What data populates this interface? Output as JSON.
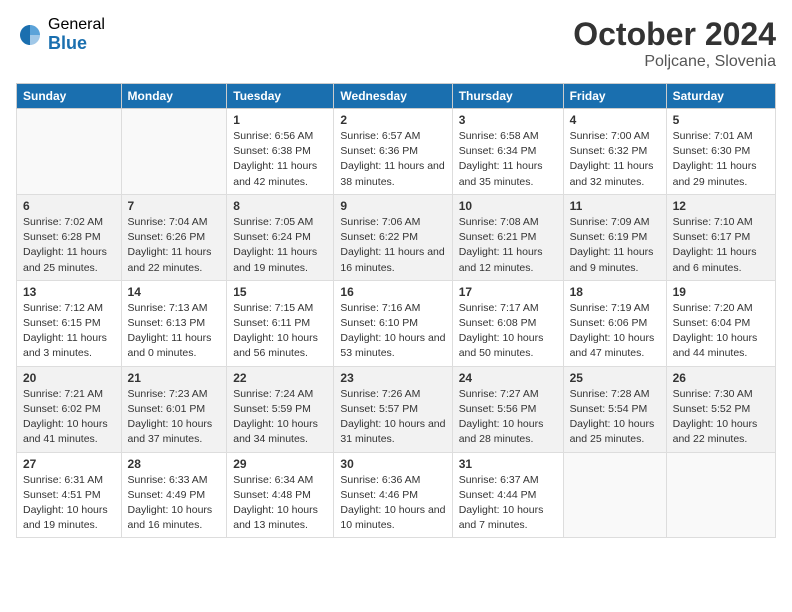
{
  "logo": {
    "general": "General",
    "blue": "Blue"
  },
  "title": {
    "month_year": "October 2024",
    "location": "Poljcane, Slovenia"
  },
  "headers": [
    "Sunday",
    "Monday",
    "Tuesday",
    "Wednesday",
    "Thursday",
    "Friday",
    "Saturday"
  ],
  "weeks": [
    [
      {
        "day": "",
        "info": ""
      },
      {
        "day": "",
        "info": ""
      },
      {
        "day": "1",
        "sunrise": "6:56 AM",
        "sunset": "6:38 PM",
        "daylight": "11 hours and 42 minutes."
      },
      {
        "day": "2",
        "sunrise": "6:57 AM",
        "sunset": "6:36 PM",
        "daylight": "11 hours and 38 minutes."
      },
      {
        "day": "3",
        "sunrise": "6:58 AM",
        "sunset": "6:34 PM",
        "daylight": "11 hours and 35 minutes."
      },
      {
        "day": "4",
        "sunrise": "7:00 AM",
        "sunset": "6:32 PM",
        "daylight": "11 hours and 32 minutes."
      },
      {
        "day": "5",
        "sunrise": "7:01 AM",
        "sunset": "6:30 PM",
        "daylight": "11 hours and 29 minutes."
      }
    ],
    [
      {
        "day": "6",
        "sunrise": "7:02 AM",
        "sunset": "6:28 PM",
        "daylight": "11 hours and 25 minutes."
      },
      {
        "day": "7",
        "sunrise": "7:04 AM",
        "sunset": "6:26 PM",
        "daylight": "11 hours and 22 minutes."
      },
      {
        "day": "8",
        "sunrise": "7:05 AM",
        "sunset": "6:24 PM",
        "daylight": "11 hours and 19 minutes."
      },
      {
        "day": "9",
        "sunrise": "7:06 AM",
        "sunset": "6:22 PM",
        "daylight": "11 hours and 16 minutes."
      },
      {
        "day": "10",
        "sunrise": "7:08 AM",
        "sunset": "6:21 PM",
        "daylight": "11 hours and 12 minutes."
      },
      {
        "day": "11",
        "sunrise": "7:09 AM",
        "sunset": "6:19 PM",
        "daylight": "11 hours and 9 minutes."
      },
      {
        "day": "12",
        "sunrise": "7:10 AM",
        "sunset": "6:17 PM",
        "daylight": "11 hours and 6 minutes."
      }
    ],
    [
      {
        "day": "13",
        "sunrise": "7:12 AM",
        "sunset": "6:15 PM",
        "daylight": "11 hours and 3 minutes."
      },
      {
        "day": "14",
        "sunrise": "7:13 AM",
        "sunset": "6:13 PM",
        "daylight": "11 hours and 0 minutes."
      },
      {
        "day": "15",
        "sunrise": "7:15 AM",
        "sunset": "6:11 PM",
        "daylight": "10 hours and 56 minutes."
      },
      {
        "day": "16",
        "sunrise": "7:16 AM",
        "sunset": "6:10 PM",
        "daylight": "10 hours and 53 minutes."
      },
      {
        "day": "17",
        "sunrise": "7:17 AM",
        "sunset": "6:08 PM",
        "daylight": "10 hours and 50 minutes."
      },
      {
        "day": "18",
        "sunrise": "7:19 AM",
        "sunset": "6:06 PM",
        "daylight": "10 hours and 47 minutes."
      },
      {
        "day": "19",
        "sunrise": "7:20 AM",
        "sunset": "6:04 PM",
        "daylight": "10 hours and 44 minutes."
      }
    ],
    [
      {
        "day": "20",
        "sunrise": "7:21 AM",
        "sunset": "6:02 PM",
        "daylight": "10 hours and 41 minutes."
      },
      {
        "day": "21",
        "sunrise": "7:23 AM",
        "sunset": "6:01 PM",
        "daylight": "10 hours and 37 minutes."
      },
      {
        "day": "22",
        "sunrise": "7:24 AM",
        "sunset": "5:59 PM",
        "daylight": "10 hours and 34 minutes."
      },
      {
        "day": "23",
        "sunrise": "7:26 AM",
        "sunset": "5:57 PM",
        "daylight": "10 hours and 31 minutes."
      },
      {
        "day": "24",
        "sunrise": "7:27 AM",
        "sunset": "5:56 PM",
        "daylight": "10 hours and 28 minutes."
      },
      {
        "day": "25",
        "sunrise": "7:28 AM",
        "sunset": "5:54 PM",
        "daylight": "10 hours and 25 minutes."
      },
      {
        "day": "26",
        "sunrise": "7:30 AM",
        "sunset": "5:52 PM",
        "daylight": "10 hours and 22 minutes."
      }
    ],
    [
      {
        "day": "27",
        "sunrise": "6:31 AM",
        "sunset": "4:51 PM",
        "daylight": "10 hours and 19 minutes."
      },
      {
        "day": "28",
        "sunrise": "6:33 AM",
        "sunset": "4:49 PM",
        "daylight": "10 hours and 16 minutes."
      },
      {
        "day": "29",
        "sunrise": "6:34 AM",
        "sunset": "4:48 PM",
        "daylight": "10 hours and 13 minutes."
      },
      {
        "day": "30",
        "sunrise": "6:36 AM",
        "sunset": "4:46 PM",
        "daylight": "10 hours and 10 minutes."
      },
      {
        "day": "31",
        "sunrise": "6:37 AM",
        "sunset": "4:44 PM",
        "daylight": "10 hours and 7 minutes."
      },
      {
        "day": "",
        "info": ""
      },
      {
        "day": "",
        "info": ""
      }
    ]
  ]
}
